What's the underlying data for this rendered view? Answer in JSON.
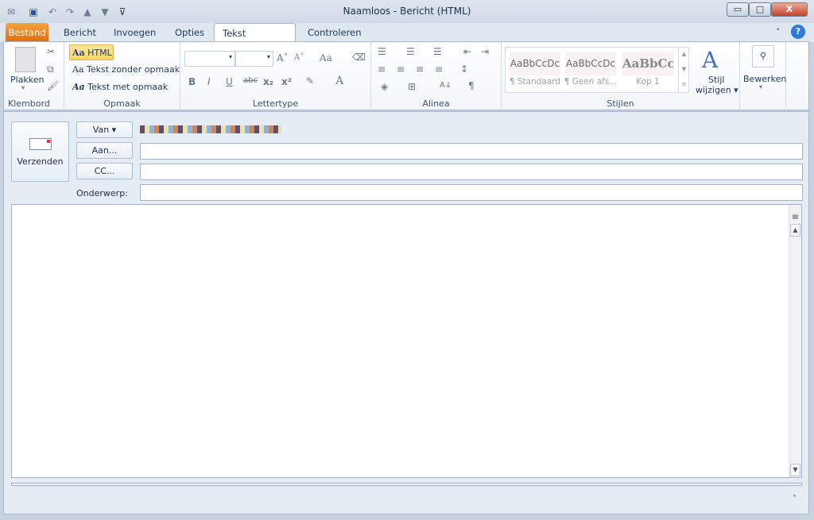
{
  "window": {
    "title": "Naamloos - Bericht (HTML)",
    "minimize": "▭",
    "restore": "□",
    "close": "X"
  },
  "tabs": [
    {
      "label": "Bestand"
    },
    {
      "label": "Bericht"
    },
    {
      "label": "Invoegen"
    },
    {
      "label": "Opties"
    },
    {
      "label": "Tekst opmaken"
    },
    {
      "label": "Controleren"
    }
  ],
  "active_tab": "Tekst opmaken",
  "ribbon": {
    "klembord": {
      "label": "Klembord",
      "paste": "Plakken"
    },
    "opmaak": {
      "label": "Opmaak",
      "html": "HTML",
      "plain": "Tekst zonder opmaak",
      "rich": "Tekst met opmaak",
      "aa": "Aa"
    },
    "lettertype": {
      "label": "Lettertype",
      "bold": "B",
      "italic": "I",
      "underline": "U",
      "strike": "abc",
      "sub": "x₂",
      "sup": "x²",
      "aa": "Aa",
      "font_color": "A",
      "grow": "A˄",
      "shrink": "A˅"
    },
    "alinea": {
      "label": "Alinea",
      "pilcrow": "¶"
    },
    "stijlen": {
      "label": "Stijlen",
      "styles": [
        {
          "preview": "AaBbCcDc",
          "name": "¶ Standaard"
        },
        {
          "preview": "AaBbCcDc",
          "name": "¶ Geen afs..."
        },
        {
          "preview": "AaBbCc",
          "name": "Kop 1"
        }
      ],
      "change_line1": "Stijl",
      "change_line2": "wijzigen ▾"
    },
    "bewerken": {
      "label": "Bewerken"
    }
  },
  "form": {
    "send": "Verzenden",
    "from": "Van ▾",
    "to": "Aan...",
    "cc": "CC...",
    "subject_label": "Onderwerp:",
    "to_value": "",
    "cc_value": "",
    "subject_value": "",
    "body": ""
  }
}
